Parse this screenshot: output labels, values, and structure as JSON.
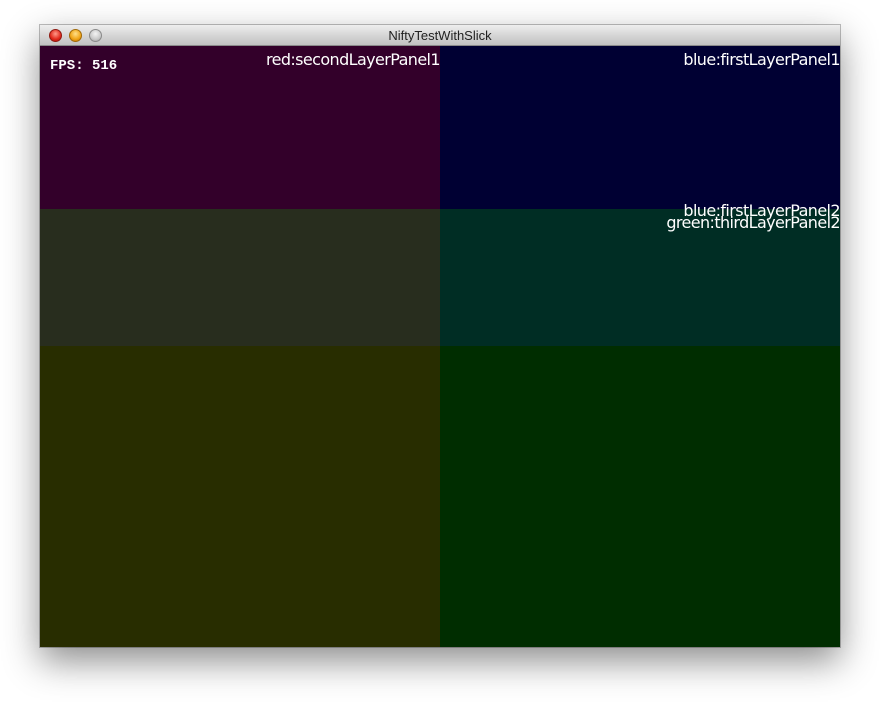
{
  "window": {
    "title": "NiftyTestWithSlick"
  },
  "hud": {
    "fps_text": "FPS: 516"
  },
  "labels": {
    "second_layer_panel1": "red:secondLayerPanel1",
    "first_layer_panel1": "blue:firstLayerPanel1",
    "first_layer_panel2": "blue:firstLayerPanel2",
    "third_layer_panel2": "green:thirdLayerPanel2"
  },
  "colors": {
    "top_left": "#33002a",
    "top_right": "#000033",
    "middle_left": "#282d1e",
    "middle_right": "#002d24",
    "bottom_left": "#282d00",
    "bottom_right": "#002d00",
    "label_text": "#ffffff"
  }
}
